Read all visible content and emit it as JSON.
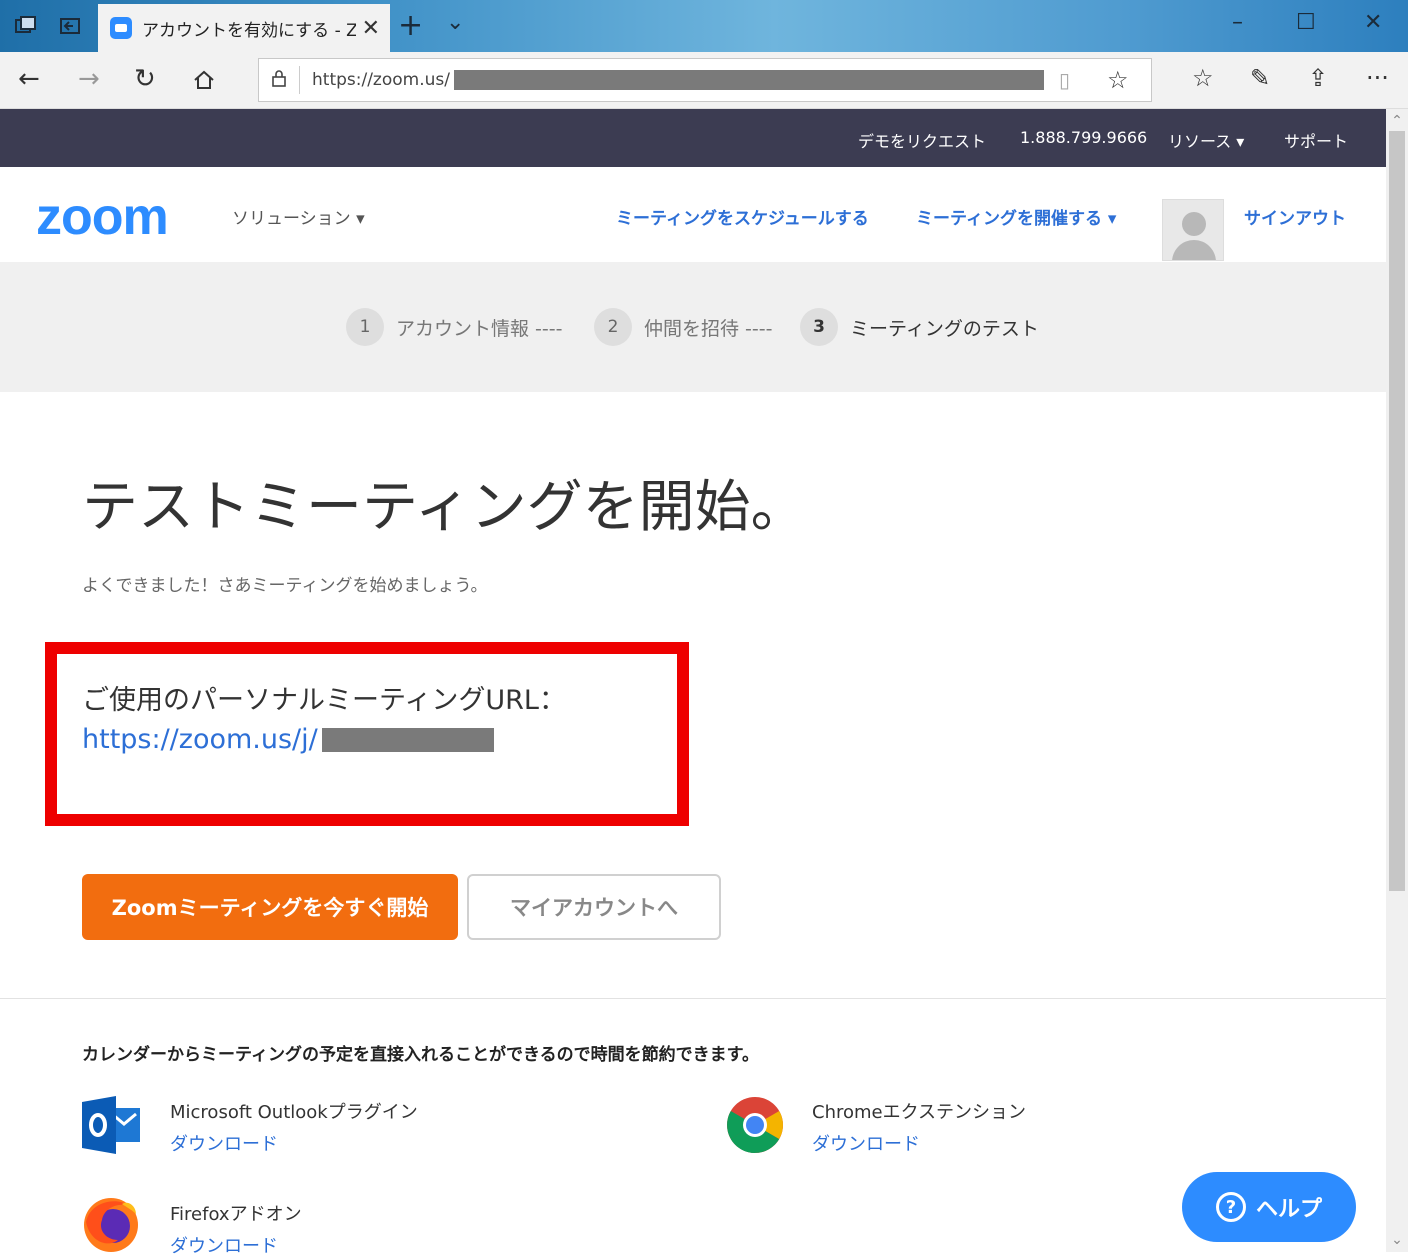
{
  "browser": {
    "tab_title": "アカウントを有効にする - Z",
    "address_prefix": "https://zoom.us/",
    "window_controls": {
      "minimize": "–",
      "maximize": "☐",
      "close": "✕"
    }
  },
  "topbar": {
    "demo": "デモをリクエスト",
    "phone": "1.888.799.9666",
    "resources": "リソース ▾",
    "support": "サポート"
  },
  "header": {
    "logo": "zoom",
    "solutions": "ソリューション ▾",
    "schedule": "ミーティングをスケジュールする",
    "host": "ミーティングを開催する ▾",
    "signout": "サインアウト"
  },
  "steps": [
    {
      "num": "1",
      "label": "アカウント情報 ----"
    },
    {
      "num": "2",
      "label": "仲間を招待 ----"
    },
    {
      "num": "3",
      "label": "ミーティングのテスト"
    }
  ],
  "main": {
    "title": "テストミーティングを開始。",
    "subtitle": "よくできました！さあミーティングを始めましょう。",
    "url_label": "ご使用のパーソナルミーティングURL：",
    "url_prefix": "https://zoom.us/j/",
    "start_button": "Zoomミーティングを今すぐ開始",
    "account_button": "マイアカウントへ"
  },
  "calendar": {
    "text": "カレンダーからミーティングの予定を直接入れることができるので時間を節約できます。",
    "plugins": [
      {
        "name": "Microsoft Outlookプラグイン",
        "download": "ダウンロード",
        "icon": "outlook-icon"
      },
      {
        "name": "Chromeエクステンション",
        "download": "ダウンロード",
        "icon": "chrome-icon"
      },
      {
        "name": "Firefoxアドオン",
        "download": "ダウンロード",
        "icon": "firefox-icon"
      }
    ]
  },
  "help": {
    "label": "ヘルプ"
  },
  "colors": {
    "zoom_blue": "#2d8cff",
    "start_orange": "#f26d0f",
    "highlight_red": "#ee0000",
    "topbar": "#3c3c52"
  }
}
